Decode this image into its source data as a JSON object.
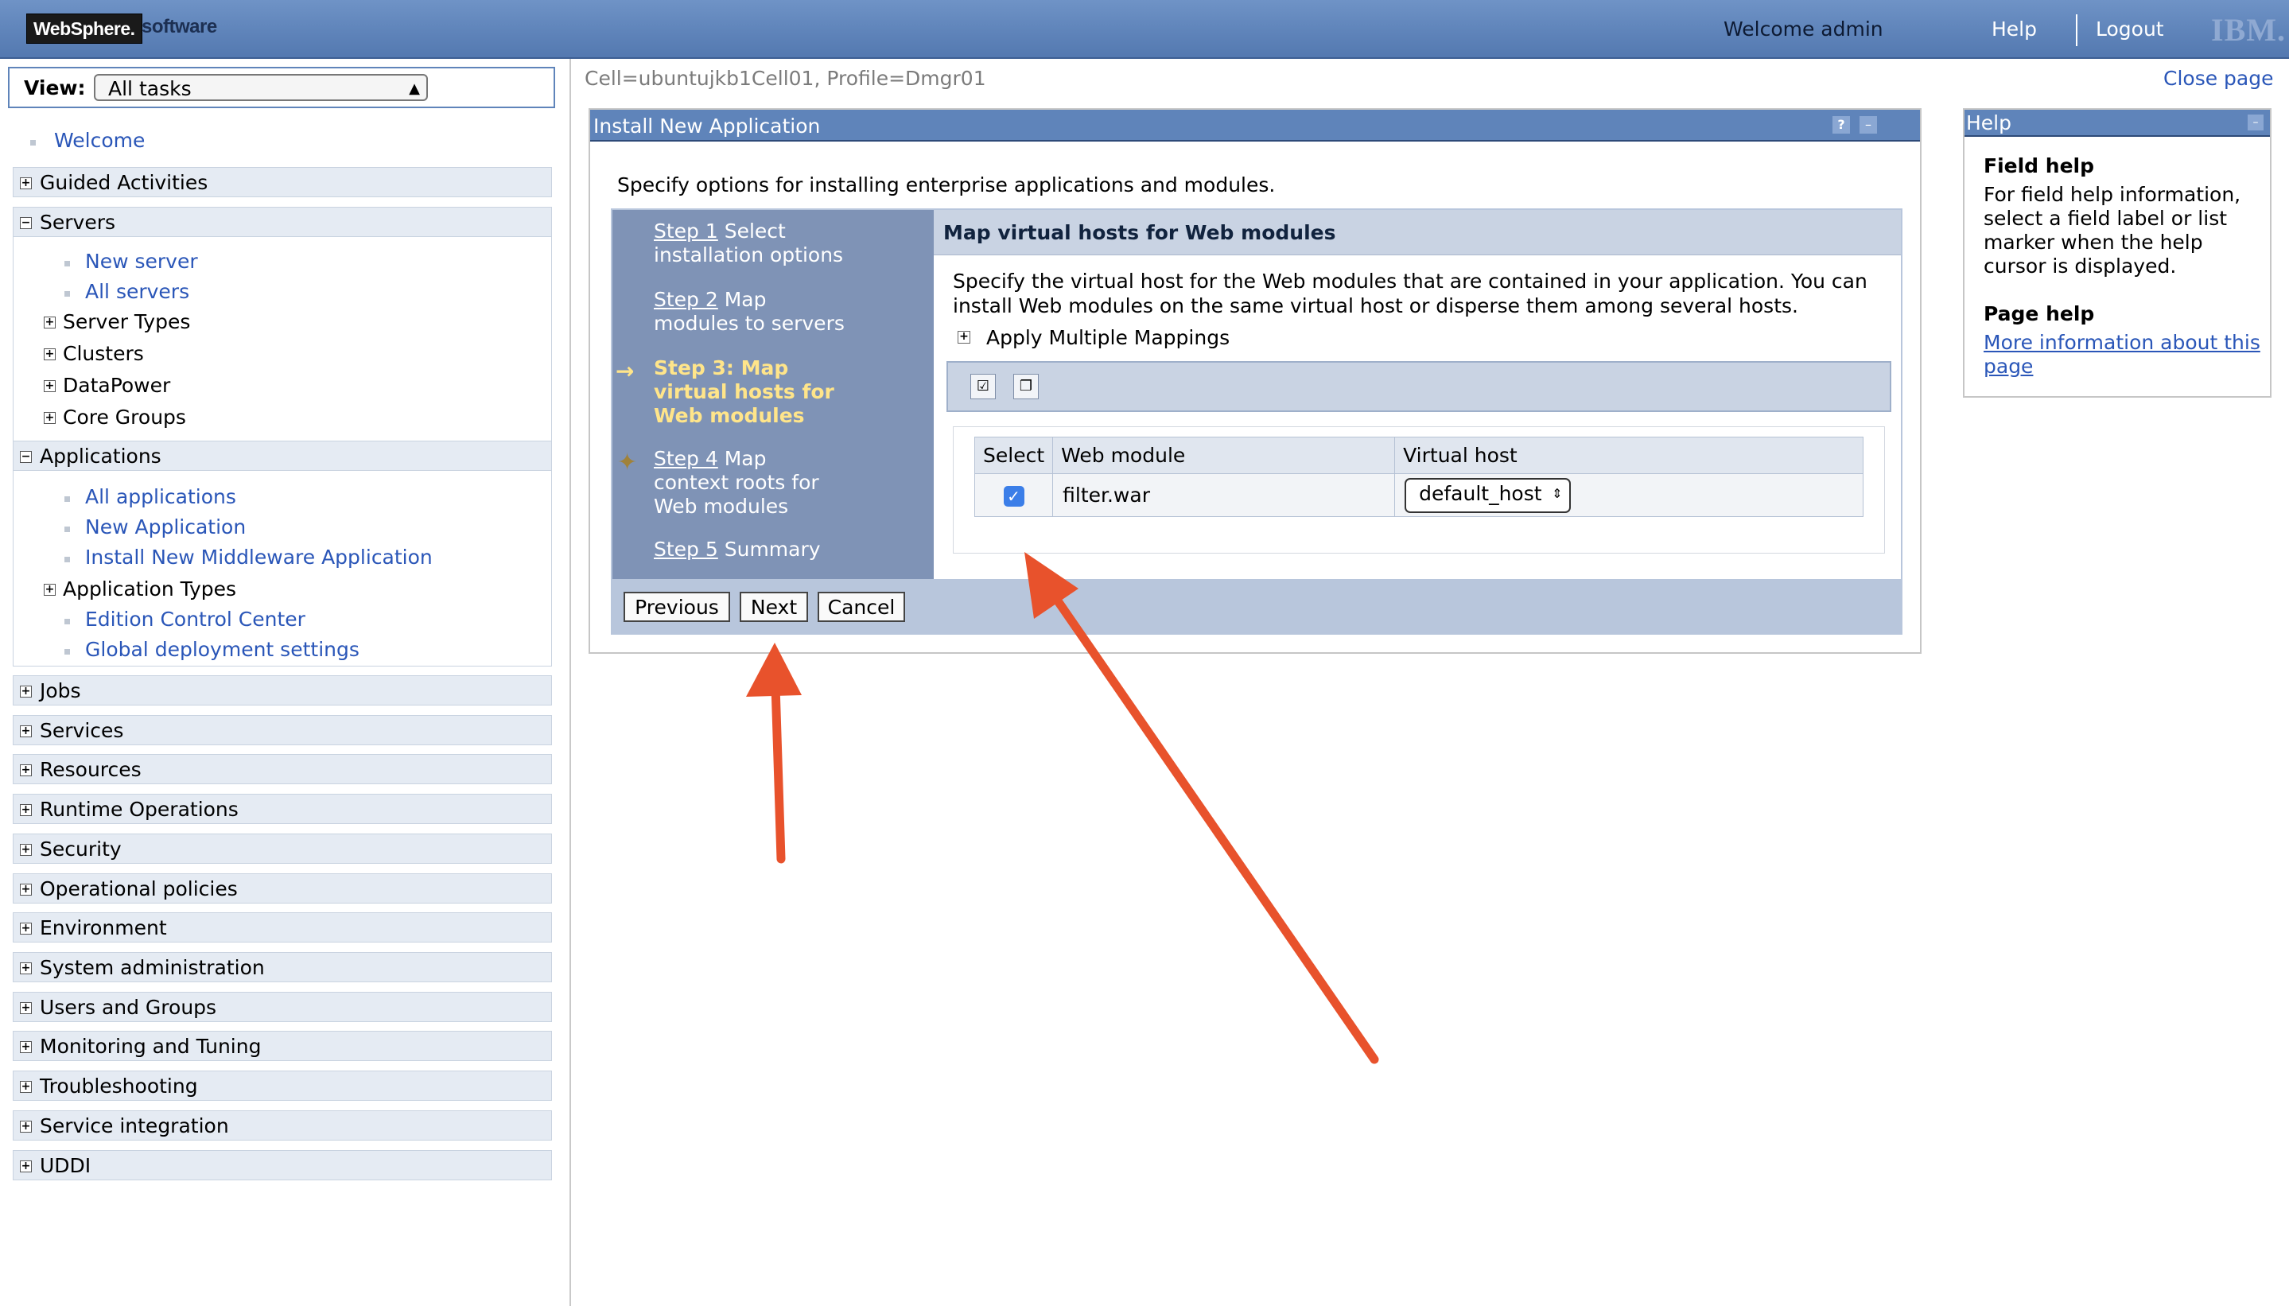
{
  "banner": {
    "logo_main": "WebSphere.",
    "logo_sub": "software",
    "welcome": "Welcome admin",
    "help": "Help",
    "logout": "Logout",
    "ibm": "IBM."
  },
  "nav": {
    "view_label": "View:",
    "view_value": "All tasks",
    "welcome_link": "Welcome",
    "guided": "Guided Activities",
    "servers": {
      "label": "Servers",
      "links": [
        "New server",
        "All servers"
      ],
      "subs": [
        "Server Types",
        "Clusters",
        "DataPower",
        "Core Groups"
      ]
    },
    "applications": {
      "label": "Applications",
      "links": [
        "All applications",
        "New Application",
        "Install New Middleware Application"
      ],
      "sub": "Application Types",
      "links2": [
        "Edition Control Center",
        "Global deployment settings"
      ]
    },
    "categories": [
      "Jobs",
      "Services",
      "Resources",
      "Runtime Operations",
      "Security",
      "Operational policies",
      "Environment",
      "System administration",
      "Users and Groups",
      "Monitoring and Tuning",
      "Troubleshooting",
      "Service integration",
      "UDDI"
    ]
  },
  "main": {
    "breadcrumb": "Cell=ubuntujkb1Cell01, Profile=Dmgr01",
    "close_page": "Close page",
    "portlet_title": "Install New Application",
    "intro": "Specify options for installing enterprise applications and modules.",
    "steps": [
      {
        "link": "Step 1",
        "rest1": " Select",
        "line2": "installation options"
      },
      {
        "link": "Step 2",
        "rest1": " Map",
        "line2": "modules to servers"
      },
      {
        "line1": "Step 3: Map",
        "line2": "virtual hosts for",
        "line3": "Web modules"
      },
      {
        "link": "Step 4",
        "rest1": " Map",
        "line2": "context roots for",
        "line3": "Web modules"
      },
      {
        "link": "Step 5",
        "rest1": " Summary"
      }
    ],
    "step_heading": "Map virtual hosts for Web modules",
    "step_desc": "Specify the virtual host for the Web modules that are contained in your application. You can install Web modules on the same virtual host or disperse them among several hosts.",
    "apply_multiple": "Apply Multiple Mappings",
    "table": {
      "headers": [
        "Select",
        "Web module",
        "Virtual host"
      ],
      "row": {
        "web_module": "filter.war",
        "virtual_host": "default_host"
      }
    },
    "buttons": {
      "previous": "Previous",
      "next": "Next",
      "cancel": "Cancel"
    }
  },
  "help": {
    "title": "Help",
    "field_help_title": "Field help",
    "field_help_text": "For field help information, select a field label or list marker when the help cursor is displayed.",
    "page_help_title": "Page help",
    "page_help_link": "More information about this page"
  },
  "colors": {
    "banner": "#5f84ba",
    "link": "#2a56b8",
    "annotation_arrow": "#e8522c",
    "current_step": "#ffe58a"
  }
}
